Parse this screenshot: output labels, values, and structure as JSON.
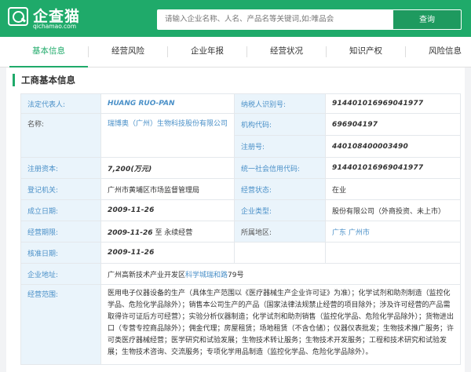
{
  "header": {
    "logo_text": "企查猫",
    "logo_sub": "qichamao.com",
    "search_placeholder": "请输入企业名称、人名、产品名等关键词,如:唯品会",
    "search_button": "查询"
  },
  "tabs": [
    "基本信息",
    "经营风险",
    "企业年报",
    "经营状况",
    "知识产权",
    "风险信息"
  ],
  "section_title": "工商基本信息",
  "fields": {
    "legal_rep_label": "法定代表人:",
    "legal_rep": "HUANG RUO-PAN",
    "taxpayer_id_label": "纳税人识别号:",
    "taxpayer_id": "914401016969041977",
    "name_label": "名称:",
    "name": "瑞博奥（广州）生物科技股份有限公司",
    "org_code_label": "机构代码:",
    "org_code": "696904197",
    "reg_no_label": "注册号:",
    "reg_no": "440108400003490",
    "capital_label": "注册资本:",
    "capital": "7,200(万元)",
    "credit_code_label": "统一社会信用代码:",
    "credit_code": "914401016969041977",
    "authority_label": "登记机关:",
    "authority": "广州市黄埔区市场监督管理局",
    "status_label": "经营状态:",
    "status": "在业",
    "founded_label": "成立日期:",
    "founded": "2009-11-26",
    "type_label": "企业类型:",
    "type": "股份有限公司（外商投资、未上市）",
    "term_label": "经营期限:",
    "term_start": "2009-11-26",
    "term_rest": " 至 永续经营",
    "region_label": "所属地区:",
    "region": "广东 广州市",
    "approval_label": "核准日期:",
    "approval": "2009-11-26",
    "address_label": "企业地址:",
    "address_pre": "广州高新技术产业开发区",
    "address_link": "科学城瑞和路",
    "address_post": "79号",
    "scope_label": "经营范围:",
    "scope": "医用电子仪器设备的生产（具体生产范围以《医疗器械生产企业许可证》为准）；化学试剂和助剂制造（监控化学品、危险化学品除外）；销售本公司生产的产品（国家法律法规禁止经营的项目除外；涉及许可经营的产品需取得许可证后方可经营）；实验分析仪器制造；化学试剂和助剂销售（监控化学品、危险化学品除外）；货物进出口（专营专控商品除外）；佣金代理；房屋租赁；场地租赁（不含仓储）；仪器仪表批发；生物技术推广服务；许可类医疗器械经营；医学研究和试验发展；生物技术转让服务；生物技术开发服务；工程和技术研究和试验发展；生物技术咨询、交流服务；专项化学用品制造（监控化学品、危险化学品除外）。"
  }
}
